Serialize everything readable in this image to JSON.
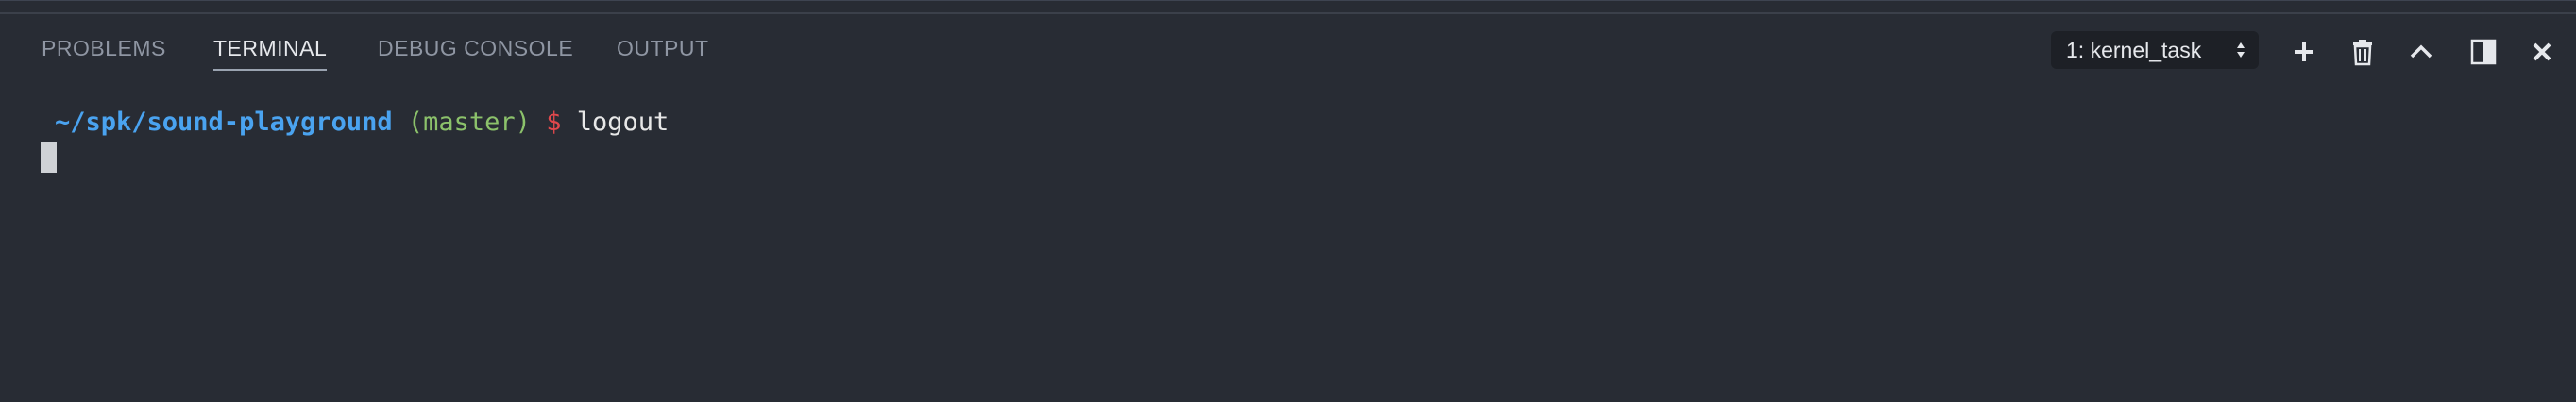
{
  "tabs": [
    {
      "label": "PROBLEMS",
      "active": false
    },
    {
      "label": "TERMINAL",
      "active": true
    },
    {
      "label": "DEBUG CONSOLE",
      "active": false
    },
    {
      "label": "OUTPUT",
      "active": false
    }
  ],
  "terminal_select": {
    "value": "1: kernel_task"
  },
  "actions": [
    {
      "icon": "plus-icon"
    },
    {
      "icon": "trash-icon"
    },
    {
      "icon": "chevron-up-icon"
    },
    {
      "icon": "split-panel-icon"
    },
    {
      "icon": "close-icon"
    }
  ],
  "terminal": {
    "path": "~/spk/sound-playground",
    "branch": "(master)",
    "prompt_symbol": "$",
    "command": "logout"
  },
  "colors": {
    "background": "#282c34",
    "path": "#4aa3f0",
    "branch": "#8cc26b",
    "prompt": "#e0484c"
  }
}
